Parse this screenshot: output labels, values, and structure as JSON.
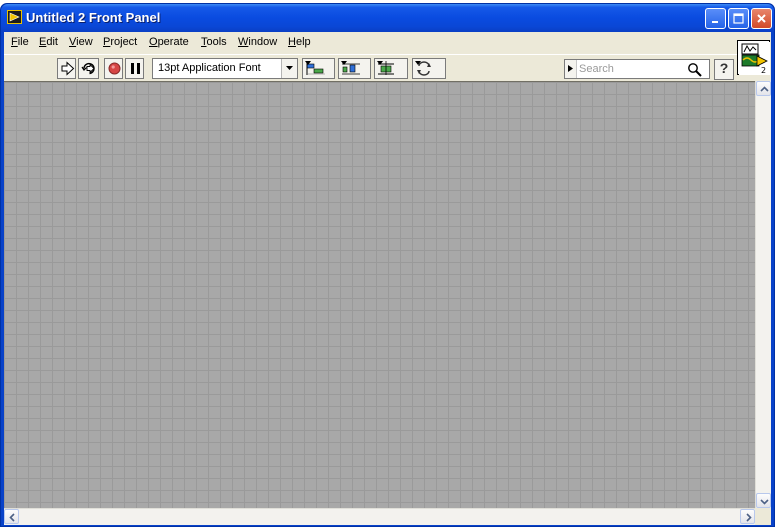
{
  "window": {
    "title": "Untitled 2 Front Panel"
  },
  "menu": {
    "items": [
      {
        "mnemonic": "F",
        "rest": "ile"
      },
      {
        "mnemonic": "E",
        "rest": "dit"
      },
      {
        "mnemonic": "V",
        "rest": "iew"
      },
      {
        "mnemonic": "P",
        "rest": "roject"
      },
      {
        "mnemonic": "O",
        "rest": "perate"
      },
      {
        "mnemonic": "T",
        "rest": "ools"
      },
      {
        "mnemonic": "W",
        "rest": "indow"
      },
      {
        "mnemonic": "H",
        "rest": "elp"
      }
    ]
  },
  "toolbar": {
    "font_selection": "13pt Application Font",
    "search_placeholder": "Search",
    "help_label": "?",
    "icons": [
      "run-arrow-icon",
      "run-continuously-icon",
      "abort-icon",
      "pause-icon",
      "align-objects-icon",
      "distribute-objects-icon",
      "resize-objects-icon",
      "reorder-icon",
      "search-icon"
    ]
  },
  "vi_icon": {
    "badge": "2"
  },
  "colors": {
    "titlebar": "#0a4be0",
    "window_bg": "#ece9d8",
    "panel_grid_bg": "#a8a8a8",
    "panel_grid_line": "#9a9a9a",
    "abort_red": "#d64545",
    "close_button": "#d24a28"
  }
}
